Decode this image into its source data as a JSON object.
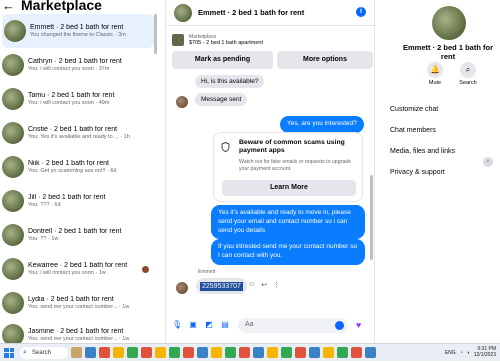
{
  "left": {
    "back_glyph": "←",
    "title": "Marketplace",
    "conversations": [
      {
        "name": "Emmett · 2 bed 1 bath for rent",
        "preview": "You changed the theme to Classic · 3m",
        "active": true
      },
      {
        "name": "Cathryn · 2 bed 1 bath for rent",
        "preview": "You: i will contact you soon · 37m"
      },
      {
        "name": "Tamu · 2 bed 1 bath for rent",
        "preview": "You: i will contact you soon · 49m"
      },
      {
        "name": "Cristie · 2 bed 1 bath for rent",
        "preview": "You: Yes it's available and ready to ... · 1h"
      },
      {
        "name": "Niik · 2 bed 1 bath for rent",
        "preview": "You: Get yo scamming ass on!!! · 6d"
      },
      {
        "name": "Jill · 2 bed 1 bath for rent",
        "preview": "You: ??? · 6d"
      },
      {
        "name": "Dontrell · 2 bed 1 bath for rent",
        "preview": "You: ?? · 1w"
      },
      {
        "name": "Kewarree · 2 bed 1 bath for rent",
        "preview": "You: i will contact you soon · 1w"
      },
      {
        "name": "Lydia · 2 bed 1 bath for rent",
        "preview": "You: send me your contact number... · 1w"
      },
      {
        "name": "Jasmine · 2 bed 1 bath for rent",
        "preview": "You: send me your contact number... · 1w"
      }
    ]
  },
  "chat": {
    "title": "Emmett · 2 bed 1 bath for rent",
    "info_glyph": "i",
    "listing": {
      "source": "Marketplace",
      "price_title": "$705 - 2 bed 1 bath apartment"
    },
    "mark_pending_label": "Mark as pending",
    "more_options_label": "More options",
    "messages": {
      "in1": "Hi, is this available?",
      "in2": "Message sent",
      "out1": "Yes, are you interested?",
      "out2": "Yes it's available and ready to move in, please send your email and contact number so i can send you details",
      "out3": "If you intrested send me your contact number so I can contact with you."
    },
    "warning": {
      "title": "Beware of common scams using payment apps",
      "body": "Watch out for fake emails or requests to upgrade your payment account.",
      "learn_more": "Learn More"
    },
    "sender_label": "Emmett",
    "phone": "2259533707",
    "composer_placeholder": "Aa"
  },
  "right": {
    "name": "Emmett · 2 bed 1 bath for rent",
    "mute_label": "Mute",
    "search_label": "Search",
    "items": [
      "Customize chat",
      "Chat members",
      "Media, files and links",
      "Privacy & support"
    ]
  },
  "taskbar": {
    "search_label": "Search",
    "lang": "ENG",
    "time": "9:31 PM",
    "date": "12/1/2023"
  }
}
